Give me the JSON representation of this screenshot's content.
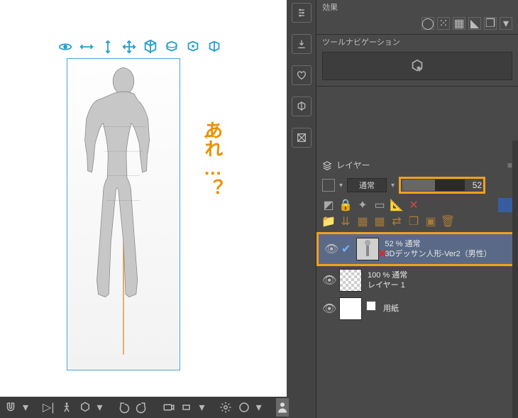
{
  "annotation": {
    "arrow": "←",
    "text": "あれ…？"
  },
  "right": {
    "effect_label": "効果",
    "toolnav_label": "ツールナビゲーション",
    "layer_panel_label": "レイヤー",
    "blend_mode": "通常",
    "opacity_value": "52",
    "layers": [
      {
        "opacity_line": "52 % 通常",
        "name": "3Dデッサン人形-Ver2（男性）"
      },
      {
        "opacity_line": "100 % 通常",
        "name": "レイヤー 1"
      },
      {
        "opacity_line": "",
        "name": "用紙"
      }
    ]
  },
  "icons": {
    "dock": [
      "param",
      "download",
      "heart",
      "cube",
      "crossbox"
    ],
    "toolbar3d": [
      "orbit",
      "pan-h",
      "pan-v",
      "move",
      "cube",
      "cube2",
      "cube-rot",
      "cube-axis"
    ],
    "bottom": [
      "magnet",
      "skip",
      "pose",
      "cube",
      "undo",
      "redo",
      "camera",
      "cam2",
      "settings",
      "render"
    ]
  }
}
